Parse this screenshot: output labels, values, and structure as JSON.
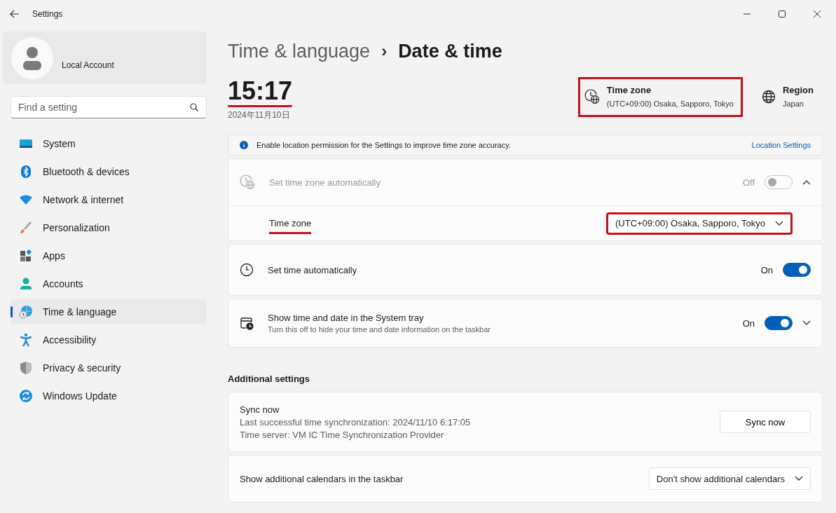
{
  "window": {
    "title": "Settings"
  },
  "account": {
    "name": "Local Account"
  },
  "search": {
    "placeholder": "Find a setting"
  },
  "nav": [
    {
      "label": "System",
      "kind": "system",
      "selected": false
    },
    {
      "label": "Bluetooth & devices",
      "kind": "bluetooth",
      "selected": false
    },
    {
      "label": "Network & internet",
      "kind": "network",
      "selected": false
    },
    {
      "label": "Personalization",
      "kind": "brush",
      "selected": false
    },
    {
      "label": "Apps",
      "kind": "apps",
      "selected": false
    },
    {
      "label": "Accounts",
      "kind": "accounts",
      "selected": false
    },
    {
      "label": "Time & language",
      "kind": "time",
      "selected": true
    },
    {
      "label": "Accessibility",
      "kind": "accessibility",
      "selected": false
    },
    {
      "label": "Privacy & security",
      "kind": "shield",
      "selected": false
    },
    {
      "label": "Windows Update",
      "kind": "update",
      "selected": false
    }
  ],
  "breadcrumb": {
    "parent": "Time & language",
    "separator": "›",
    "current": "Date & time"
  },
  "clock": {
    "time": "15:17",
    "date": "2024年11月10日",
    "highlighted": true
  },
  "summary": [
    {
      "kind": "timezone",
      "title": "Time zone",
      "value": "(UTC+09:00) Osaka, Sapporo, Tokyo",
      "highlighted": true
    },
    {
      "kind": "region",
      "title": "Region",
      "value": "Japan",
      "highlighted": false
    }
  ],
  "banner": {
    "text": "Enable location permission for the Settings to improve time zone accuracy.",
    "link": "Location Settings"
  },
  "timezone_card": {
    "label": "Set time zone automatically",
    "state_text": "Off",
    "on": false,
    "disabled": true,
    "expanded": true,
    "sub": {
      "label": "Time zone",
      "label_highlighted": true,
      "value": "(UTC+09:00) Osaka, Sapporo, Tokyo",
      "value_highlighted": true
    }
  },
  "toggle_rows": [
    {
      "kind": "clock",
      "label": "Set time automatically",
      "state_text": "On",
      "on": true
    },
    {
      "kind": "tray",
      "label": "Show time and date in the System tray",
      "subtitle": "Turn this off to hide your time and date information on the taskbar",
      "state_text": "On",
      "on": true,
      "expanded": false
    }
  ],
  "additional": {
    "heading": "Additional settings",
    "sync": {
      "title": "Sync now",
      "lines": [
        "Last successful time synchronization: 2024/11/10 6:17:05",
        "Time server: VM IC Time Synchronization Provider"
      ],
      "button": "Sync now"
    },
    "calendars": {
      "label": "Show additional calendars in the taskbar",
      "value": "Don't show additional calendars"
    }
  }
}
